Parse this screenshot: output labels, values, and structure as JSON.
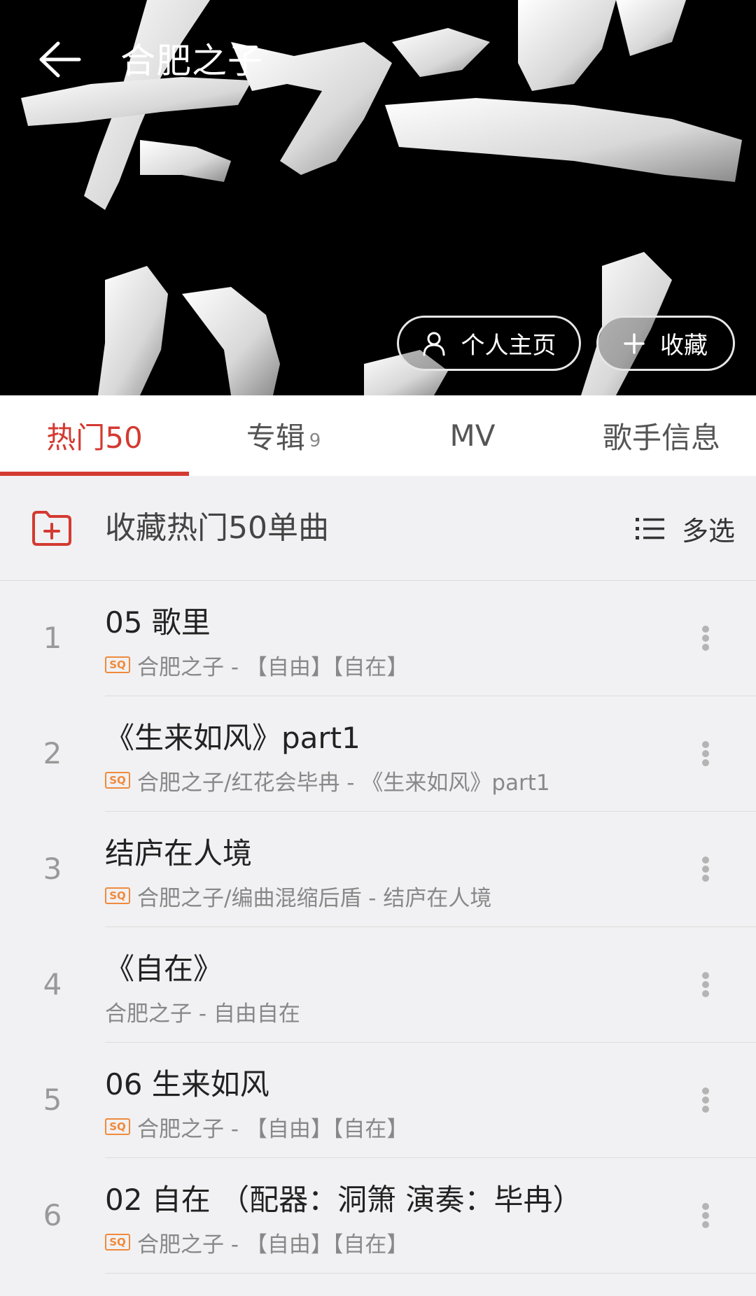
{
  "header": {
    "title": "合肥之子",
    "profile_button": "个人主页",
    "favorite_button": "收藏"
  },
  "tabs": [
    {
      "label": "热门50",
      "badge": "",
      "active": true
    },
    {
      "label": "专辑",
      "badge": "9",
      "active": false
    },
    {
      "label": "MV",
      "badge": "",
      "active": false
    },
    {
      "label": "歌手信息",
      "badge": "",
      "active": false
    }
  ],
  "collect": {
    "label": "收藏热门50单曲",
    "multi_select": "多选"
  },
  "sq_label": "SQ",
  "songs": [
    {
      "index": "1",
      "title": "05 歌里",
      "meta": "合肥之子 - 【自由】【自在】",
      "sq": true
    },
    {
      "index": "2",
      "title": "《生来如风》part1",
      "meta": "合肥之子/红花会毕冉 - 《生来如风》part1",
      "sq": true
    },
    {
      "index": "3",
      "title": "结庐在人境",
      "meta": "合肥之子/编曲混缩后盾 - 结庐在人境",
      "sq": true
    },
    {
      "index": "4",
      "title": "《自在》",
      "meta": "合肥之子 - 自由自在",
      "sq": false
    },
    {
      "index": "5",
      "title": "06 生来如风",
      "meta": "合肥之子 - 【自由】【自在】",
      "sq": true
    },
    {
      "index": "6",
      "title": "02 自在 （配器：洞箫 演奏：毕冉）",
      "meta": "合肥之子 - 【自由】【自在】",
      "sq": true
    }
  ],
  "colors": {
    "accent": "#d33a31",
    "sq_badge": "#f08a3c",
    "banner_bg": "#000000"
  }
}
